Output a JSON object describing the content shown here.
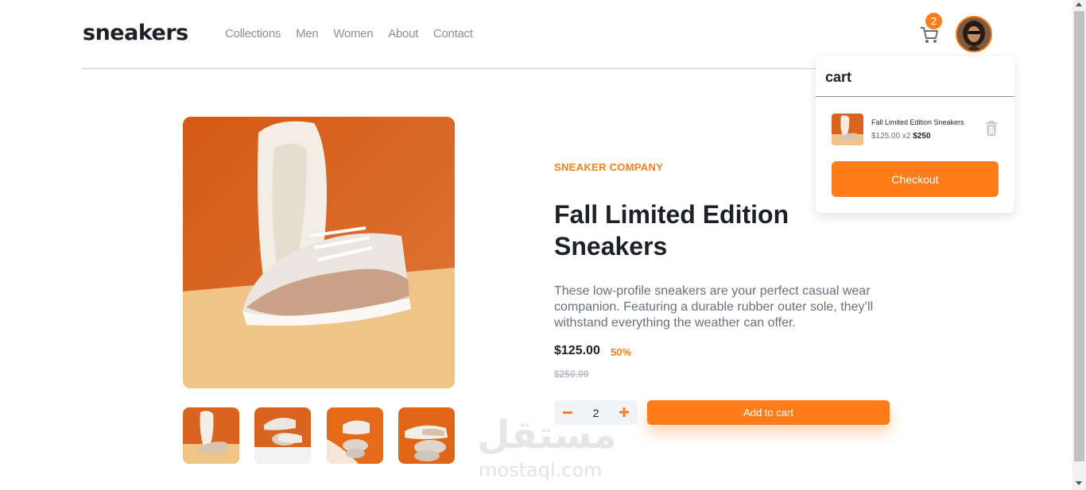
{
  "header": {
    "logo": "sneakers",
    "nav": [
      "Collections",
      "Men",
      "Women",
      "About",
      "Contact"
    ],
    "cart_count": "2"
  },
  "cart": {
    "title": "cart",
    "item_name": "Fall Limited Edition Sneakers",
    "item_unit": "$125.00 x2",
    "item_total": "$250",
    "checkout_label": "Checkout"
  },
  "product": {
    "company": "SNEAKER COMPANY",
    "title": "Fall Limited Edition Sneakers",
    "description": "These low-profile sneakers are your perfect casual wear companion. Featuring a durable rubber outer sole, they’ll withstand everything the weather can offer.",
    "price": "$125.00",
    "discount": "50%",
    "old_price": "$250.00",
    "quantity": "2",
    "add_to_cart_label": "Add to cart"
  },
  "watermark": {
    "arabic": "مستقل",
    "latin": "mostaql.com"
  },
  "colors": {
    "accent": "#ff7e1b",
    "dark": "#1d2026",
    "gray": "#68707d"
  },
  "icons": [
    "cart-icon",
    "trash-icon",
    "minus-icon",
    "plus-icon"
  ]
}
